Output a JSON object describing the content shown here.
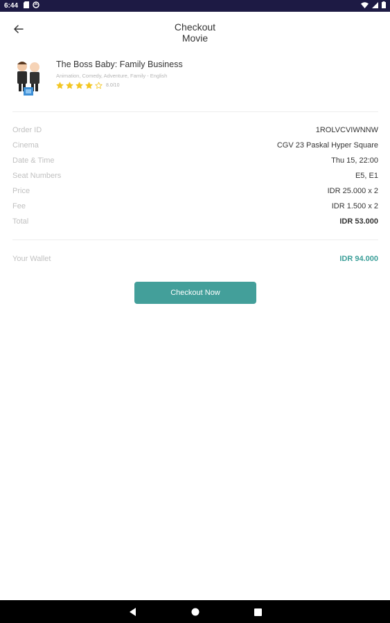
{
  "status_bar": {
    "time": "6:44",
    "icons_left": [
      "sd-card-icon",
      "sync-icon"
    ],
    "icons_right": [
      "wifi-icon",
      "signal-icon",
      "battery-icon"
    ]
  },
  "header": {
    "title_line1": "Checkout",
    "title_line2": "Movie"
  },
  "movie": {
    "title": "The Boss Baby: Family Business",
    "genre_language": "Animation, Comedy, Adventure, Family - English",
    "rating_text": "8.0/10",
    "stars_filled": 4,
    "stars_total": 5,
    "star_color": "#f3c623"
  },
  "order": {
    "rows": [
      {
        "label": "Order ID",
        "value": "1ROLVCVIWNNW"
      },
      {
        "label": "Cinema",
        "value": "CGV 23 Paskal Hyper Square"
      },
      {
        "label": "Date & Time",
        "value": "Thu 15, 22:00"
      },
      {
        "label": "Seat Numbers",
        "value": "E5, E1"
      },
      {
        "label": "Price",
        "value": "IDR 25.000 x 2"
      },
      {
        "label": "Fee",
        "value": "IDR 1.500 x 2"
      },
      {
        "label": "Total",
        "value": "IDR 53.000"
      }
    ]
  },
  "wallet": {
    "label": "Your Wallet",
    "value": "IDR 94.000",
    "value_color": "#3a9e98"
  },
  "checkout_button": {
    "label": "Checkout Now",
    "color": "#439f9a"
  },
  "nav": {
    "icons": [
      "back-triangle-icon",
      "home-circle-icon",
      "recents-square-icon"
    ]
  }
}
